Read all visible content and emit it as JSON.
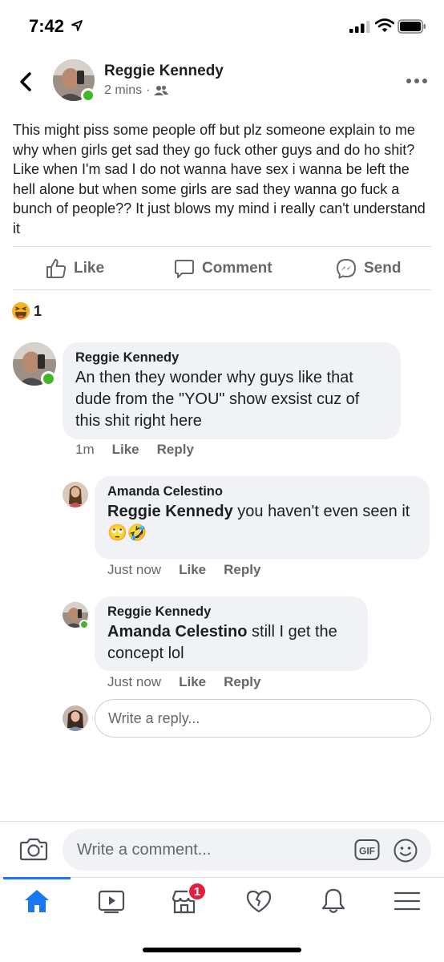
{
  "status_bar": {
    "time": "7:42"
  },
  "post": {
    "author": "Reggie Kennedy",
    "time": "2 mins",
    "meta_separator": "·",
    "text": "This might piss some people off but plz someone explain to me why when girls get sad they go fuck other guys and do ho shit? Like when I'm sad I do not wanna have sex i wanna be left the hell alone but when some girls are sad they wanna go fuck a bunch of people?? It just blows my mind i really can't understand it"
  },
  "actions": {
    "like": "Like",
    "comment": "Comment",
    "send": "Send"
  },
  "reactions": {
    "count": "1",
    "icon": "haha-emoji-icon"
  },
  "comments": [
    {
      "author": "Reggie Kennedy",
      "text": "An then they wonder why guys like that dude from the \"YOU\" show exsist cuz of this shit right here",
      "time": "1m",
      "like": "Like",
      "reply": "Reply",
      "replies": [
        {
          "author": "Amanda Celestino",
          "mention": "Reggie Kennedy",
          "text": " you haven't even seen it 🙄🤣",
          "time": "Just now",
          "like": "Like",
          "reply": "Reply"
        },
        {
          "author": "Reggie Kennedy",
          "mention": "Amanda Celestino",
          "text": " still I get the concept lol",
          "time": "Just now",
          "like": "Like",
          "reply": "Reply"
        }
      ]
    }
  ],
  "reply_input": {
    "placeholder": "Write a reply..."
  },
  "composer": {
    "placeholder": "Write a comment...",
    "gif_label": "GIF"
  },
  "nav": {
    "marketplace_badge": "1"
  },
  "colors": {
    "accent": "#1877f2",
    "online": "#42b72a",
    "badge": "#e41e3f",
    "bubble": "#f0f2f5"
  }
}
